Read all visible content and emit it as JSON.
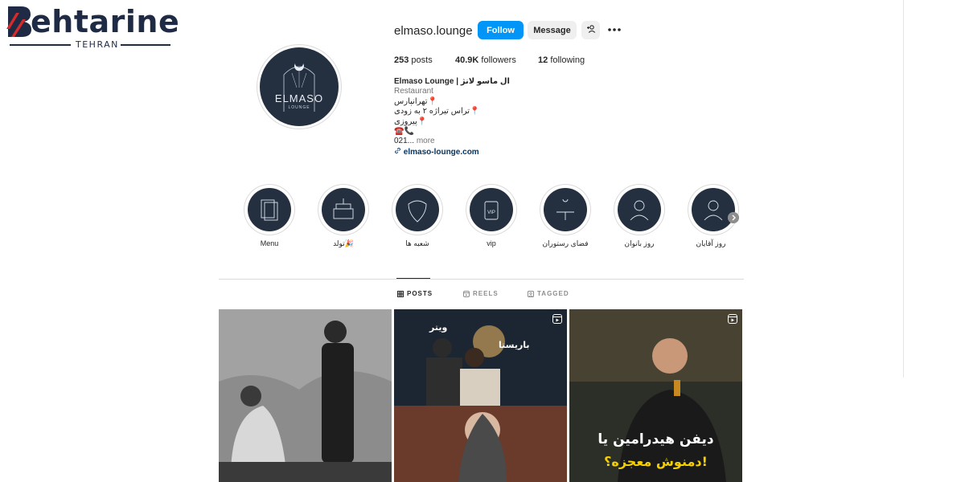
{
  "watermark": {
    "brand": "ehtarine",
    "city": "TEHRAN"
  },
  "profile": {
    "username": "elmaso.lounge",
    "follow_label": "Follow",
    "message_label": "Message",
    "avatar": {
      "word": "ELMASO",
      "sub": "LOUNGE"
    },
    "stats": {
      "posts_count": "253",
      "posts_label": "posts",
      "followers_count": "40.9K",
      "followers_label": "followers",
      "following_count": "12",
      "following_label": "following"
    },
    "bio": {
      "name": "Elmaso Lounge | ال ماسو لانژ",
      "category": "Restaurant",
      "line1": "تهرانپارس",
      "line2": "تراس تیراژه ۲ به زودی",
      "line3": "پیروزی",
      "line5": "021...",
      "more": "more",
      "link": "elmaso-lounge.com"
    }
  },
  "highlights": [
    {
      "label": "Menu"
    },
    {
      "label": "تولد🎉"
    },
    {
      "label": "شعبه ها"
    },
    {
      "label": "vip"
    },
    {
      "label": "فضای رستوران"
    },
    {
      "label": "روز بانوان"
    },
    {
      "label": "روز آقایان"
    }
  ],
  "tabs": {
    "posts": "POSTS",
    "reels": "REELS",
    "tagged": "TAGGED"
  },
  "posts": [
    {
      "kind": "image"
    },
    {
      "kind": "reel",
      "tag1": "ویتر",
      "tag2": "باریستا"
    },
    {
      "kind": "reel",
      "caption1": "دیفن هیدرامین یا",
      "caption2": "دمنوش معجزه؟!"
    }
  ],
  "colors": {
    "accent": "#0095f6",
    "avatar_bg": "#243040",
    "link": "#00376b"
  }
}
